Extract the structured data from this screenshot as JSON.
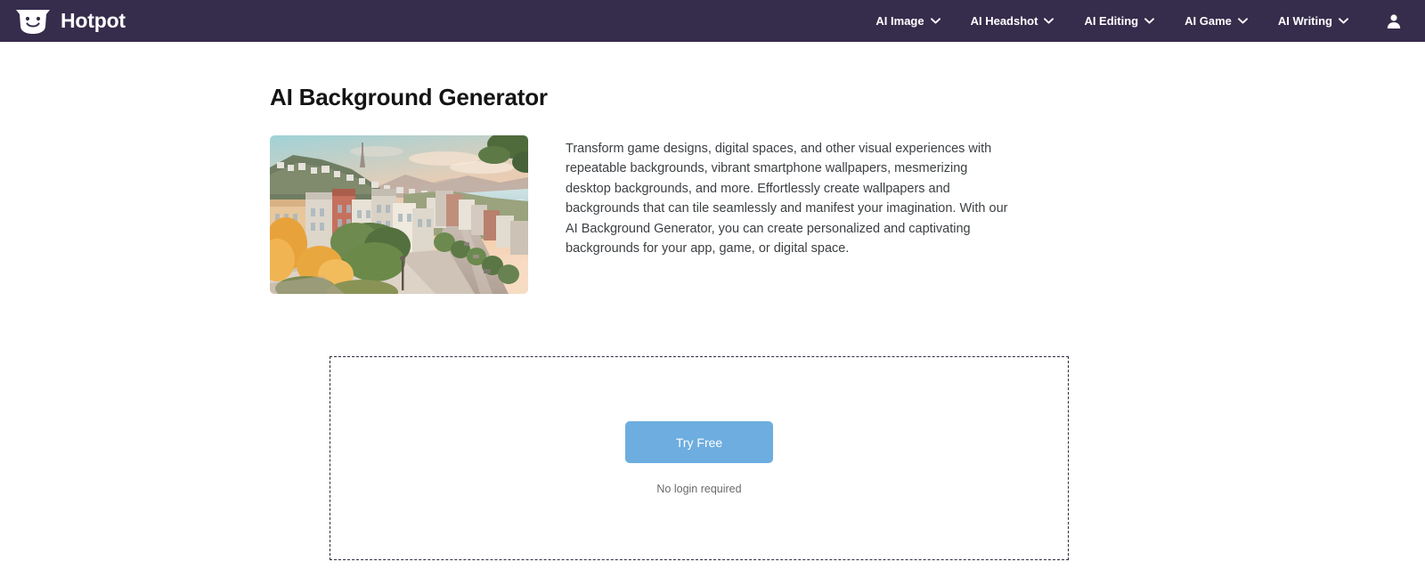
{
  "header": {
    "brand_name": "Hotpot",
    "logo_icon": "hotpot-smiley-pot-icon",
    "nav_items": [
      {
        "label": "AI Image",
        "icon": "chevron-down-icon"
      },
      {
        "label": "AI Headshot",
        "icon": "chevron-down-icon"
      },
      {
        "label": "AI Editing",
        "icon": "chevron-down-icon"
      },
      {
        "label": "AI Game",
        "icon": "chevron-down-icon"
      },
      {
        "label": "AI Writing",
        "icon": "chevron-down-icon"
      }
    ],
    "account_icon": "user-account-icon",
    "background_color": "#362c4c"
  },
  "main": {
    "title": "AI Background Generator",
    "hero_image_alt": "Illustrated San Francisco hillside street at golden hour with bay view",
    "description": "Transform game designs, digital spaces, and other visual experiences with repeatable backgrounds, vibrant smartphone wallpapers, mesmerizing desktop backgrounds, and more. Effortlessly create wallpapers and backgrounds that can tile seamlessly and manifest your imagination. With our AI Background Generator, you can create personalized and captivating backgrounds for your app, game, or digital space."
  },
  "dropzone": {
    "cta_label": "Try Free",
    "cta_color": "#6daddf",
    "note": "No login required"
  }
}
